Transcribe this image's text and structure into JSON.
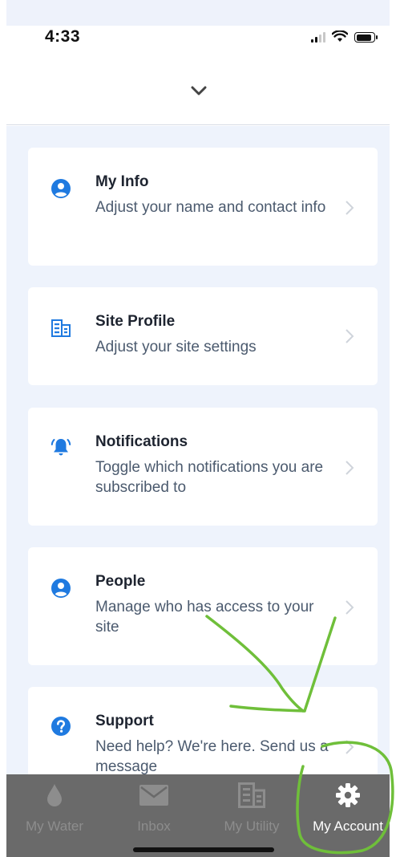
{
  "status_bar": {
    "time": "4:33"
  },
  "header": {
    "collapse_icon": "chevron-down-icon"
  },
  "cards": [
    {
      "icon": "user-circle-icon",
      "title": "My Info",
      "description": "Adjust your name and contact info"
    },
    {
      "icon": "building-icon",
      "title": "Site Profile",
      "description": "Adjust your site settings"
    },
    {
      "icon": "bell-icon",
      "title": "Notifications",
      "description": "Toggle which notifications you are subscribed to"
    },
    {
      "icon": "user-circle-icon",
      "title": "People",
      "description": "Manage who has access to your site"
    },
    {
      "icon": "question-circle-icon",
      "title": "Support",
      "description": "Need help? We're here. Send us a message"
    }
  ],
  "tabbar": {
    "tabs": [
      {
        "label": "My Water",
        "icon": "water-drop-icon",
        "active": false
      },
      {
        "label": "Inbox",
        "icon": "envelope-icon",
        "active": false
      },
      {
        "label": "My Utility",
        "icon": "building-icon",
        "active": false
      },
      {
        "label": "My Account",
        "icon": "gear-icon",
        "active": true
      }
    ]
  },
  "colors": {
    "accent": "#1f7ae0",
    "content_bg": "#eef3fc",
    "tabbar_bg": "#6a6a6a",
    "annotation": "#6fbf3a"
  }
}
